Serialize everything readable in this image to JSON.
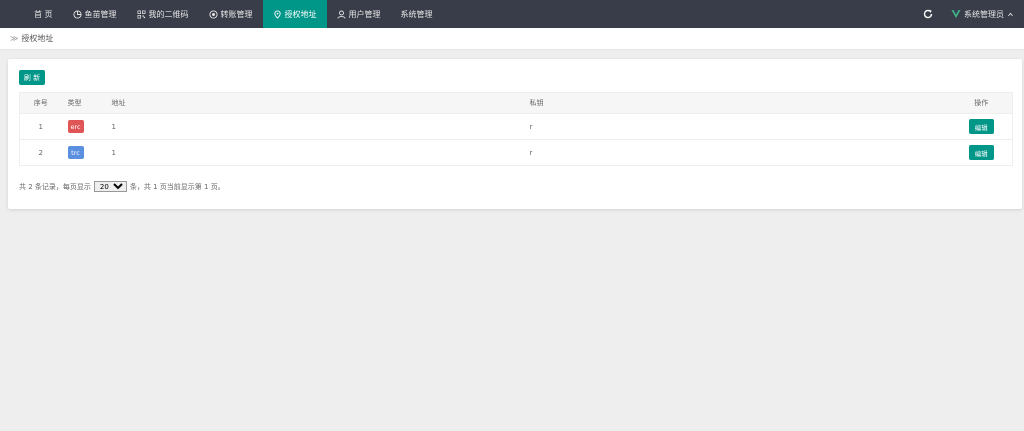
{
  "nav": {
    "items": [
      {
        "label": "首 页",
        "icon": "",
        "active": false
      },
      {
        "label": "鱼苗管理",
        "icon": "chart-icon",
        "active": false
      },
      {
        "label": "我的二维码",
        "icon": "qrcode-icon",
        "active": false
      },
      {
        "label": "转账管理",
        "icon": "transfer-icon",
        "active": false
      },
      {
        "label": "授权地址",
        "icon": "location-icon",
        "active": true
      },
      {
        "label": "用户管理",
        "icon": "user-icon",
        "active": false
      },
      {
        "label": "系统管理",
        "icon": "",
        "active": false
      }
    ],
    "user": "系统管理员"
  },
  "breadcrumb": {
    "current": "授权地址"
  },
  "toolbar": {
    "refresh_label": "刷 新"
  },
  "table": {
    "headers": {
      "index": "序号",
      "type": "类型",
      "address": "地址",
      "key": "私钥",
      "action": "操作"
    },
    "rows": [
      {
        "index": "1",
        "type": "erc",
        "type_color": "#e05656",
        "address": "1",
        "key": "r",
        "action": "编辑"
      },
      {
        "index": "2",
        "type": "trc",
        "type_color": "#5b8fe0",
        "address": "1",
        "key": "r",
        "action": "编辑"
      }
    ]
  },
  "pager": {
    "prefix": "共 2 条记录，每页显示",
    "page_size": "20",
    "suffix": "条，共 1 页当前显示第 1 页。"
  },
  "colors": {
    "nav_bg": "#393d49",
    "accent": "#009688"
  }
}
